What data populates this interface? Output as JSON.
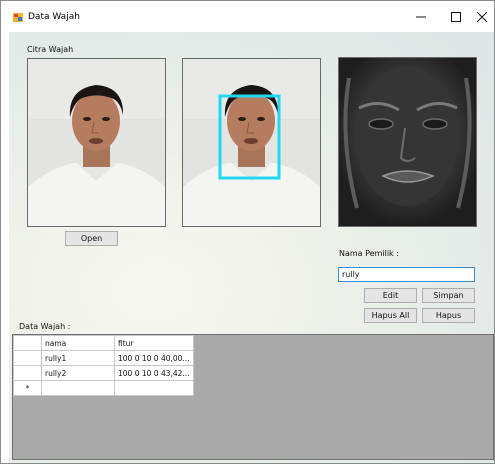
{
  "window": {
    "title": "Data Wajah",
    "controls": {
      "minimize": "–",
      "maximize": "☐",
      "close": "✕"
    }
  },
  "labels": {
    "citra_wajah": "Citra Wajah",
    "nama_pemilik": "Nama Pemilik :",
    "data_wajah": "Data Wajah :"
  },
  "buttons": {
    "open": "Open",
    "edit": "Edit",
    "simpan": "Simpan",
    "hapus_all": "Hapus All",
    "hapus": "Hapus"
  },
  "name_input": {
    "value": "rully"
  },
  "grid": {
    "columns": [
      "nama",
      "fitur"
    ],
    "rows": [
      [
        "rully1",
        "100 0 10 0 40,00..."
      ],
      [
        "rully2",
        "100 0 10 0 43,42..."
      ]
    ],
    "new_row_marker": "*"
  },
  "images": {
    "original": "face-photo",
    "detected": "face-photo-with-detection-box",
    "processed": "grayscale-edge-face",
    "detection_box_color": "#22d8ee"
  }
}
